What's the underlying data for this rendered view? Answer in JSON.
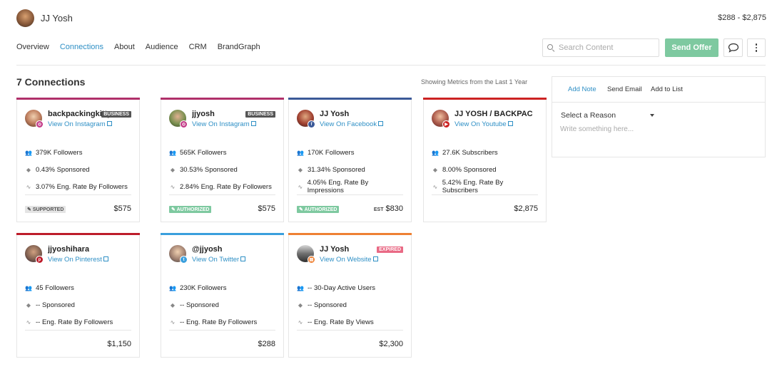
{
  "header": {
    "name": "JJ Yosh",
    "price_range": "$288 - $2,875"
  },
  "nav": [
    "Overview",
    "Connections",
    "About",
    "Audience",
    "CRM",
    "BrandGraph"
  ],
  "active_nav": "Connections",
  "search": {
    "placeholder": "Search Content"
  },
  "actions": {
    "send_offer": "Send Offer"
  },
  "section": {
    "title": "7 Connections",
    "metrics_note": "Showing Metrics from the Last 1 Year"
  },
  "panel": {
    "tabs": [
      "Add Note",
      "Send Email",
      "Add to List"
    ],
    "reason_label": "Select a Reason",
    "note_placeholder": "Write something here..."
  },
  "cards": [
    {
      "name": "backpackingkitty",
      "link": "View On Instagram",
      "platform": "instagram-icon",
      "color": "#b0306a",
      "tag": "BUSINESS",
      "stats": [
        "379K Followers",
        "0.43% Sponsored",
        "3.07% Eng. Rate By Followers"
      ],
      "status": "SUPPORTED",
      "est": "",
      "price": "$575"
    },
    {
      "name": "jjyosh",
      "link": "View On Instagram",
      "platform": "instagram-icon",
      "color": "#b0306a",
      "tag": "BUSINESS",
      "stats": [
        "565K Followers",
        "30.53% Sponsored",
        "2.84% Eng. Rate By Followers"
      ],
      "status": "AUTHORIZED",
      "est": "",
      "price": "$575"
    },
    {
      "name": "JJ Yosh",
      "link": "View On Facebook",
      "platform": "facebook-icon",
      "color": "#3b5998",
      "tag": "",
      "stats": [
        "170K Followers",
        "31.34% Sponsored",
        "4.05% Eng. Rate By Impressions"
      ],
      "status": "AUTHORIZED",
      "est": "EST",
      "price": "$830"
    },
    {
      "name": "JJ YOSH / BACKPAC...",
      "link": "View On Youtube",
      "platform": "youtube-icon",
      "color": "#cc2222",
      "tag": "",
      "stats": [
        "27.6K Subscribers",
        "8.00% Sponsored",
        "5.42% Eng. Rate By Subscribers"
      ],
      "status": "",
      "est": "",
      "price": "$2,875"
    },
    {
      "name": "jjyoshihara",
      "link": "View On Pinterest",
      "platform": "pinterest-icon",
      "color": "#bd1c2a",
      "tag": "",
      "stats": [
        "45 Followers",
        "-- Sponsored",
        "-- Eng. Rate By Followers"
      ],
      "status": "",
      "est": "",
      "price": "$1,150"
    },
    {
      "name": "@jjyosh",
      "link": "View On Twitter",
      "platform": "twitter-icon",
      "color": "#3a9fdd",
      "tag": "",
      "stats": [
        "230K Followers",
        "-- Sponsored",
        "-- Eng. Rate By Followers"
      ],
      "status": "",
      "est": "",
      "price": "$288"
    },
    {
      "name": "JJ Yosh",
      "link": "View On Website",
      "platform": "website-icon",
      "color": "#ee8033",
      "tag": "EXPIRED",
      "stats": [
        "-- 30-Day Active Users",
        "-- Sponsored",
        "-- Eng. Rate By Views"
      ],
      "status": "",
      "est": "",
      "price": "$2,300"
    }
  ]
}
